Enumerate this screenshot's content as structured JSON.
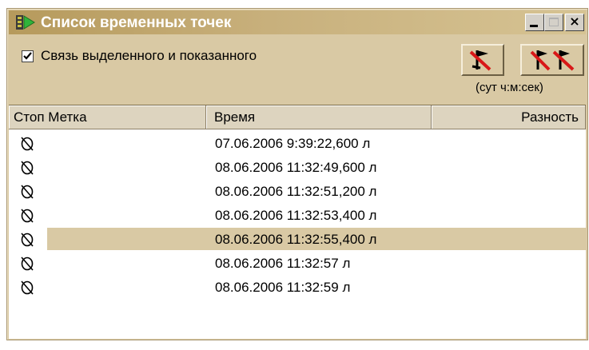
{
  "window": {
    "title": "Список временных точек",
    "accent_color": "#b69a5c",
    "controls": {
      "minimize": "_",
      "maximize": "□",
      "close": "×"
    }
  },
  "options": {
    "link_checkbox_label": "Связь выделенного и показанного",
    "link_checkbox_checked": true
  },
  "toolbar": {
    "buttons": [
      {
        "icon": "delete-mark-icon"
      },
      {
        "icon": "delete-all-marks-icon"
      }
    ],
    "units_label": "(сут ч:м:сек)"
  },
  "table": {
    "columns": [
      "Стоп Метка",
      "Время",
      "Разность"
    ],
    "rows": [
      {
        "icon": "stop-mark-icon",
        "time": "07.06.2006 9:39:22,600 л",
        "diff": "",
        "selected": false
      },
      {
        "icon": "stop-mark-icon",
        "time": "08.06.2006 11:32:49,600 л",
        "diff": "",
        "selected": false
      },
      {
        "icon": "stop-mark-icon",
        "time": "08.06.2006 11:32:51,200 л",
        "diff": "",
        "selected": false
      },
      {
        "icon": "stop-mark-icon",
        "time": "08.06.2006 11:32:53,400 л",
        "diff": "",
        "selected": false
      },
      {
        "icon": "stop-mark-icon",
        "time": "08.06.2006 11:32:55,400 л",
        "diff": "",
        "selected": true
      },
      {
        "icon": "stop-mark-icon",
        "time": "08.06.2006 11:32:57 л",
        "diff": "",
        "selected": false
      },
      {
        "icon": "stop-mark-icon",
        "time": "08.06.2006 11:32:59 л",
        "diff": "",
        "selected": false
      }
    ]
  }
}
